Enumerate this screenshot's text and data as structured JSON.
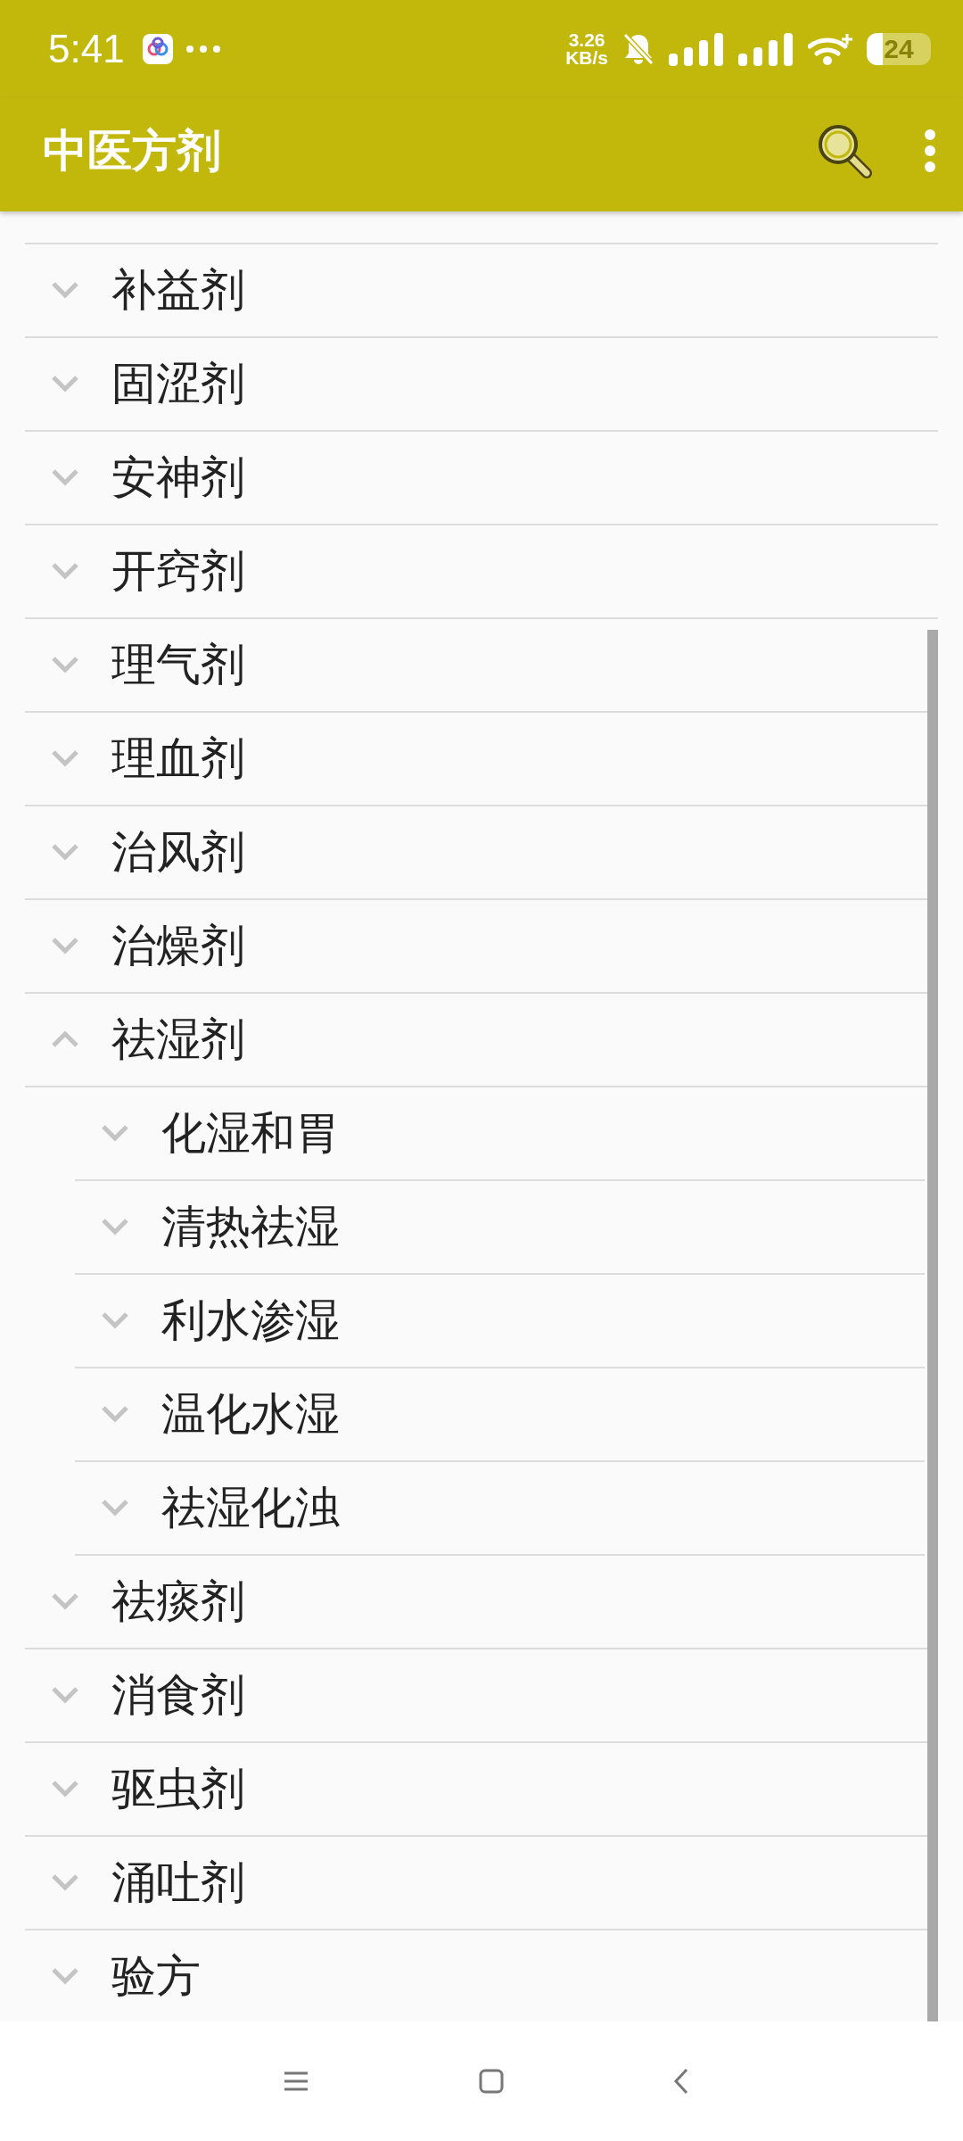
{
  "status_bar": {
    "time": "5:41",
    "network_speed": "3.26",
    "network_unit": "KB/s",
    "battery": "24"
  },
  "toolbar": {
    "title": "中医方剂"
  },
  "tree": [
    {
      "label": "补益剂",
      "expanded": false
    },
    {
      "label": "固涩剂",
      "expanded": false
    },
    {
      "label": "安神剂",
      "expanded": false
    },
    {
      "label": "开窍剂",
      "expanded": false
    },
    {
      "label": "理气剂",
      "expanded": false
    },
    {
      "label": "理血剂",
      "expanded": false
    },
    {
      "label": "治风剂",
      "expanded": false
    },
    {
      "label": "治燥剂",
      "expanded": false
    },
    {
      "label": "祛湿剂",
      "expanded": true,
      "children": [
        {
          "label": "化湿和胃",
          "expanded": false
        },
        {
          "label": "清热祛湿",
          "expanded": false
        },
        {
          "label": "利水渗湿",
          "expanded": false
        },
        {
          "label": "温化水湿",
          "expanded": false
        },
        {
          "label": "祛湿化浊",
          "expanded": false
        }
      ]
    },
    {
      "label": "祛痰剂",
      "expanded": false
    },
    {
      "label": "消食剂",
      "expanded": false
    },
    {
      "label": "驱虫剂",
      "expanded": false
    },
    {
      "label": "涌吐剂",
      "expanded": false
    },
    {
      "label": "验方",
      "expanded": false
    }
  ]
}
